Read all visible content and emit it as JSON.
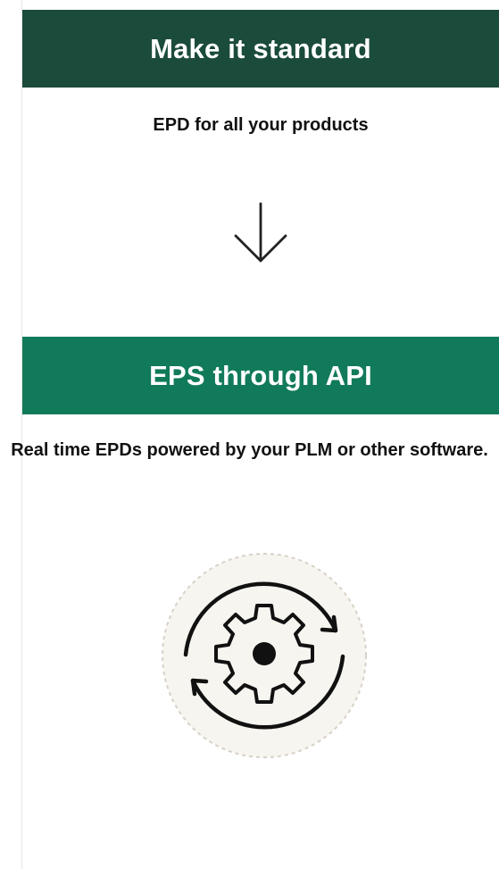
{
  "sections": [
    {
      "title": "Make it standard",
      "subtitle": "EPD for all your products",
      "icon": "arrow-down-icon",
      "header_color": "#1b4b3b"
    },
    {
      "title": "EPS through API",
      "subtitle": "Real time EPDs powered by your PLM or other software.",
      "icon": "gear-sync-icon",
      "header_color": "#117a5a"
    }
  ]
}
